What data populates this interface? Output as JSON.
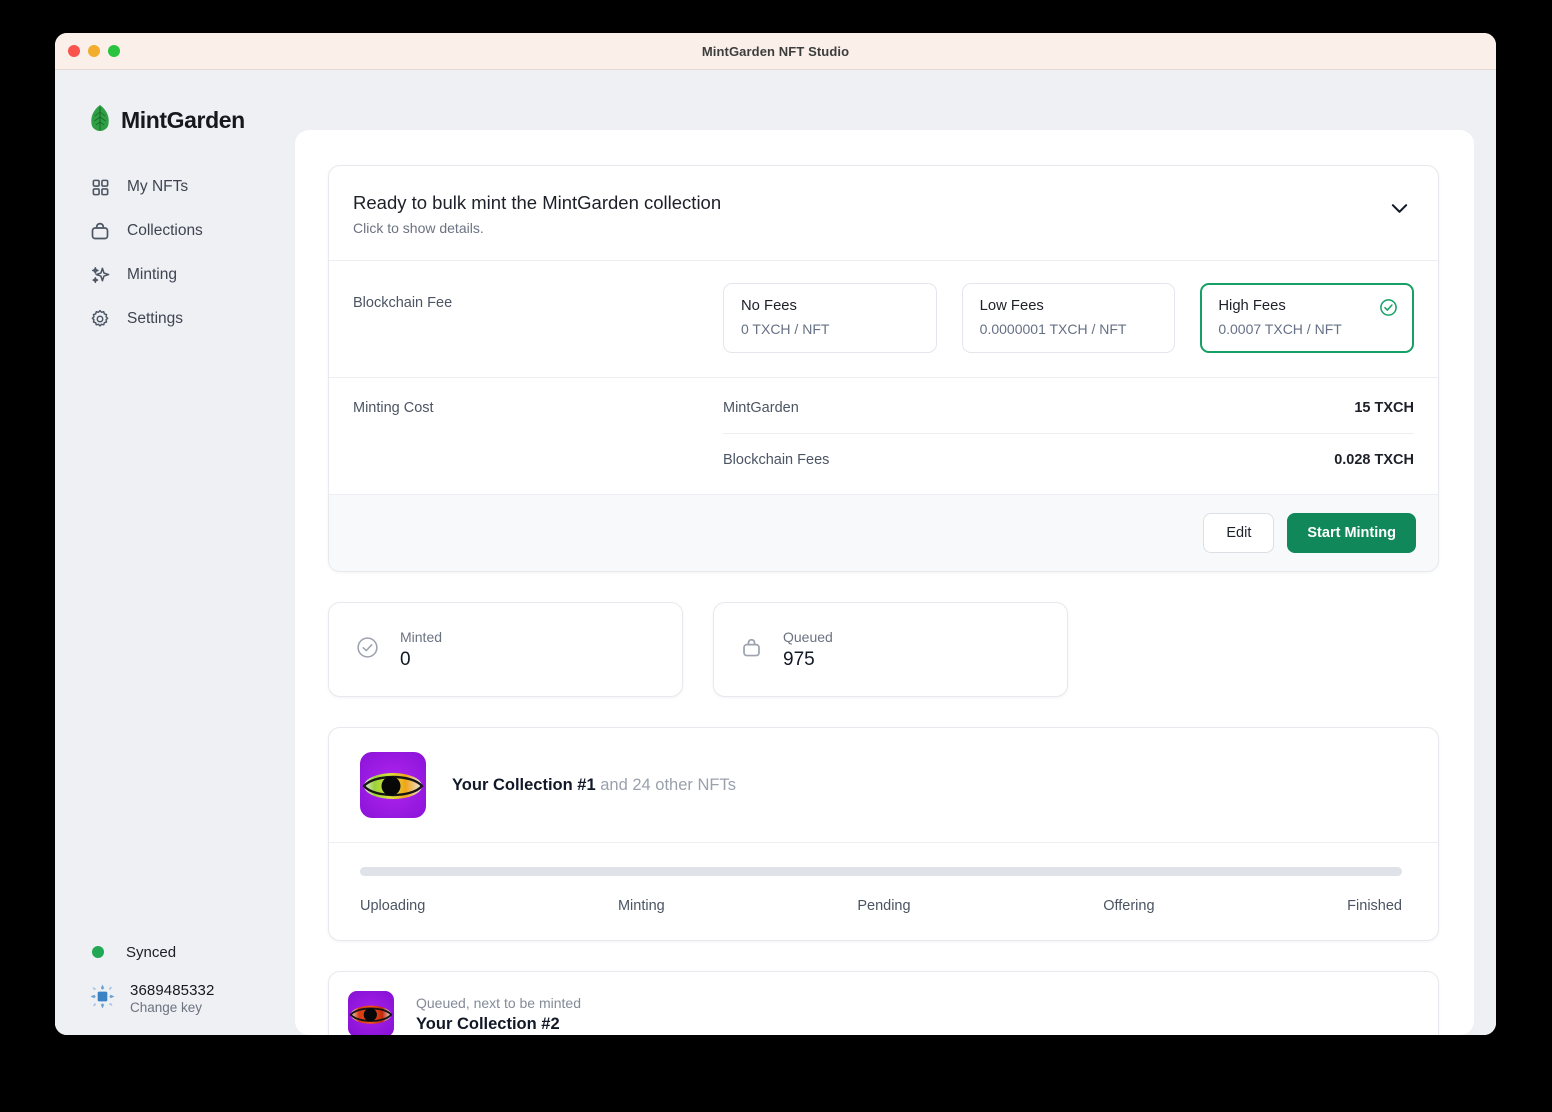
{
  "window": {
    "title": "MintGarden NFT Studio"
  },
  "sidebar": {
    "brand": "MintGarden",
    "items": [
      {
        "label": "My NFTs",
        "icon": "grid-icon"
      },
      {
        "label": "Collections",
        "icon": "collections-icon"
      },
      {
        "label": "Minting",
        "icon": "sparkles-icon"
      },
      {
        "label": "Settings",
        "icon": "gear-icon"
      }
    ],
    "status": {
      "label": "Synced",
      "color": "#22a752"
    },
    "key": {
      "id": "3689485332",
      "action": "Change key"
    }
  },
  "mint_card": {
    "title": "Ready to bulk mint the MintGarden collection",
    "subtitle": "Click to show details.",
    "fee_label": "Blockchain Fee",
    "fee_options": [
      {
        "name": "No Fees",
        "value": "0 TXCH / NFT",
        "selected": false
      },
      {
        "name": "Low Fees",
        "value": "0.0000001 TXCH / NFT",
        "selected": false
      },
      {
        "name": "High Fees",
        "value": "0.0007 TXCH / NFT",
        "selected": true
      }
    ],
    "cost_label": "Minting Cost",
    "costs": [
      {
        "key": "MintGarden",
        "amount": "15 TXCH"
      },
      {
        "key": "Blockchain Fees",
        "amount": "0.028 TXCH"
      }
    ],
    "edit_label": "Edit",
    "start_label": "Start Minting",
    "accent": "#11885a"
  },
  "stats": [
    {
      "label": "Minted",
      "value": "0",
      "icon": "check-circle-icon"
    },
    {
      "label": "Queued",
      "value": "975",
      "icon": "collections-icon"
    }
  ],
  "collection": {
    "name": "Your Collection #1",
    "suffix": "and 24 other NFTs",
    "progress_percent": 0,
    "steps": [
      "Uploading",
      "Minting",
      "Pending",
      "Offering",
      "Finished"
    ]
  },
  "queued_item": {
    "status": "Queued, next to be minted",
    "name": "Your Collection #2"
  }
}
